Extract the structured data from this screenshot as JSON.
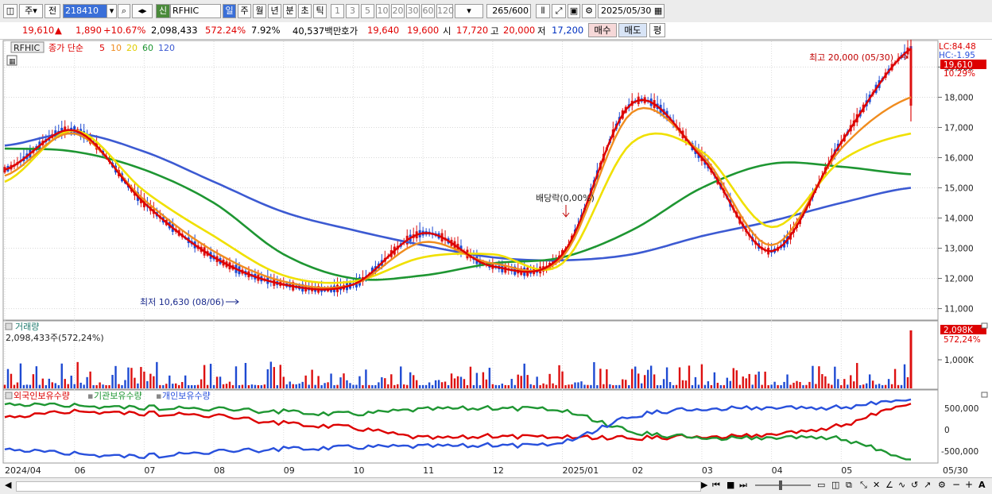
{
  "toolbar": {
    "period_mode": "주",
    "prev_label": "전",
    "code": "218410",
    "badge": "신",
    "name": "RFHIC",
    "period_buttons": [
      "일",
      "주",
      "월",
      "년",
      "분",
      "초",
      "틱"
    ],
    "minute_buttons": [
      "1",
      "3",
      "5",
      "10",
      "20",
      "30",
      "60",
      "120"
    ],
    "count": "265",
    "count_total": "/600",
    "date": "2025/05/30"
  },
  "quote": {
    "price": "19,610",
    "change": "1,890",
    "change_pct": "+10.67%",
    "volume": "2,098,433",
    "volume_ratio": "572.24%",
    "turnover": "7.92%",
    "amount": "40,537백만",
    "ask_label": "호가",
    "ask": "19,640",
    "bid": "19,600",
    "open_label": "시",
    "open": "17,720",
    "high_label": "고",
    "high": "20,000",
    "low_label": "저",
    "low": "17,200",
    "buy_label": "매수",
    "sell_label": "매도",
    "eval_label": "평"
  },
  "main_chart": {
    "symbol_tag": "RFHIC",
    "legend_prefix": "종가 단순",
    "ma_periods": [
      "5",
      "10",
      "20",
      "60",
      "120"
    ],
    "ma_colors": [
      "#dd0000",
      "#f08c1e",
      "#f0e000",
      "#1e9632",
      "#3c5ad2"
    ],
    "y_ticks": [
      "19,000",
      "18,000",
      "17,000",
      "16,000",
      "15,000",
      "14,000",
      "13,000",
      "12,000",
      "11,000"
    ],
    "lc_label": "LC:84.48",
    "hc_label": "HC:-1.95",
    "price_box": "19,610",
    "price_pct": "10.29%",
    "high_annotation": "최고 20,000 (05/30)",
    "low_annotation": "최저 10,630 (08/06)",
    "dividend_annotation": "배당락(0,00%)"
  },
  "volume_chart": {
    "title": "거래량",
    "readout": "2,098,433주(572,24%)",
    "last_box": "2,098K",
    "last_pct": "572,24%",
    "tick": "1,000K"
  },
  "holdings_chart": {
    "legend": [
      "외국인보유수량",
      "기관보유수량",
      "개인보유수량"
    ],
    "legend_colors": [
      "#dd0000",
      "#1e9632",
      "#2850dc"
    ],
    "ticks": [
      "500,000",
      "0",
      "-500,000"
    ]
  },
  "x_axis": {
    "labels": [
      "2024/04",
      "06",
      "07",
      "08",
      "09",
      "10",
      "11",
      "12",
      "2025/01",
      "02",
      "03",
      "04",
      "05"
    ],
    "last_date": "05/30"
  },
  "chart_data": {
    "type": "line",
    "x": [
      "2024/04",
      "06",
      "07",
      "08",
      "09",
      "10",
      "11",
      "12",
      "2025/01",
      "02",
      "03",
      "04",
      "05",
      "05/30"
    ],
    "series": [
      {
        "name": "5",
        "values": [
          15600,
          16900,
          14500,
          12700,
          11800,
          11800,
          13500,
          12400,
          12800,
          17800,
          16000,
          12900,
          16500,
          19610
        ]
      },
      {
        "name": "10",
        "values": [
          15400,
          16800,
          14600,
          12900,
          11900,
          11800,
          13200,
          12500,
          12700,
          17500,
          16100,
          13100,
          16300,
          18000
        ]
      },
      {
        "name": "20",
        "values": [
          15200,
          16900,
          14900,
          13400,
          12100,
          11900,
          12700,
          12800,
          12500,
          16500,
          16200,
          13700,
          15900,
          16800
        ]
      },
      {
        "name": "60",
        "values": [
          16300,
          16200,
          15600,
          14500,
          12800,
          12000,
          12100,
          12500,
          12700,
          13600,
          15000,
          15800,
          15700,
          15450
        ]
      },
      {
        "name": "120",
        "values": [
          16400,
          16800,
          16200,
          15200,
          14200,
          13600,
          13100,
          12700,
          12600,
          12800,
          13400,
          13900,
          14500,
          15000
        ]
      }
    ],
    "ylim": [
      10700,
      19800
    ],
    "annotations": [
      {
        "label": "최고 20,000 (05/30)",
        "value": 20000
      },
      {
        "label": "최저 10,630 (08/06)",
        "value": 10630
      }
    ]
  }
}
